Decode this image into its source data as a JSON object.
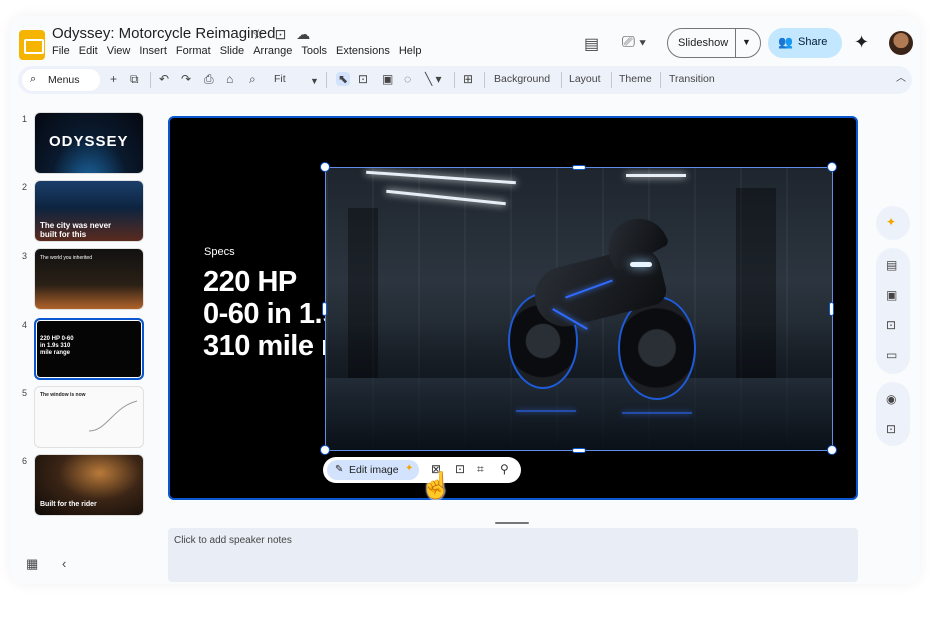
{
  "app": {
    "title": "Odyssey: Motorcycle Reimagined",
    "menu": [
      "File",
      "Edit",
      "View",
      "Insert",
      "Format",
      "Slide",
      "Arrange",
      "Tools",
      "Extensions",
      "Help"
    ],
    "slideshow_label": "Slideshow",
    "share_label": "Share"
  },
  "toolbar": {
    "search_label": "Menus",
    "zoom_label": "Fit",
    "background_label": "Background",
    "layout_label": "Layout",
    "theme_label": "Theme",
    "transition_label": "Transition"
  },
  "filmstrip": {
    "slides": [
      {
        "number": "1",
        "title": "ODYSSEY"
      },
      {
        "number": "2",
        "title": "The city was never built for this"
      },
      {
        "number": "3",
        "title": "The world you inherited"
      },
      {
        "number": "4",
        "title": "220 HP 0-60 in 1.9s 310 mile range",
        "selected": true
      },
      {
        "number": "5",
        "title": "The window is now"
      },
      {
        "number": "6",
        "title": "Built for the rider"
      }
    ]
  },
  "slide": {
    "label": "Specs",
    "lines": [
      "220 HP",
      "0-60 in 1.9s",
      "310 mile range"
    ],
    "image_toolbar": {
      "edit_label": "Edit image"
    }
  },
  "notes": {
    "placeholder": "Click to add speaker notes"
  },
  "colors": {
    "accent": "#0b57d0",
    "share_bg": "#c2e7ff",
    "logo": "#f4b400"
  }
}
